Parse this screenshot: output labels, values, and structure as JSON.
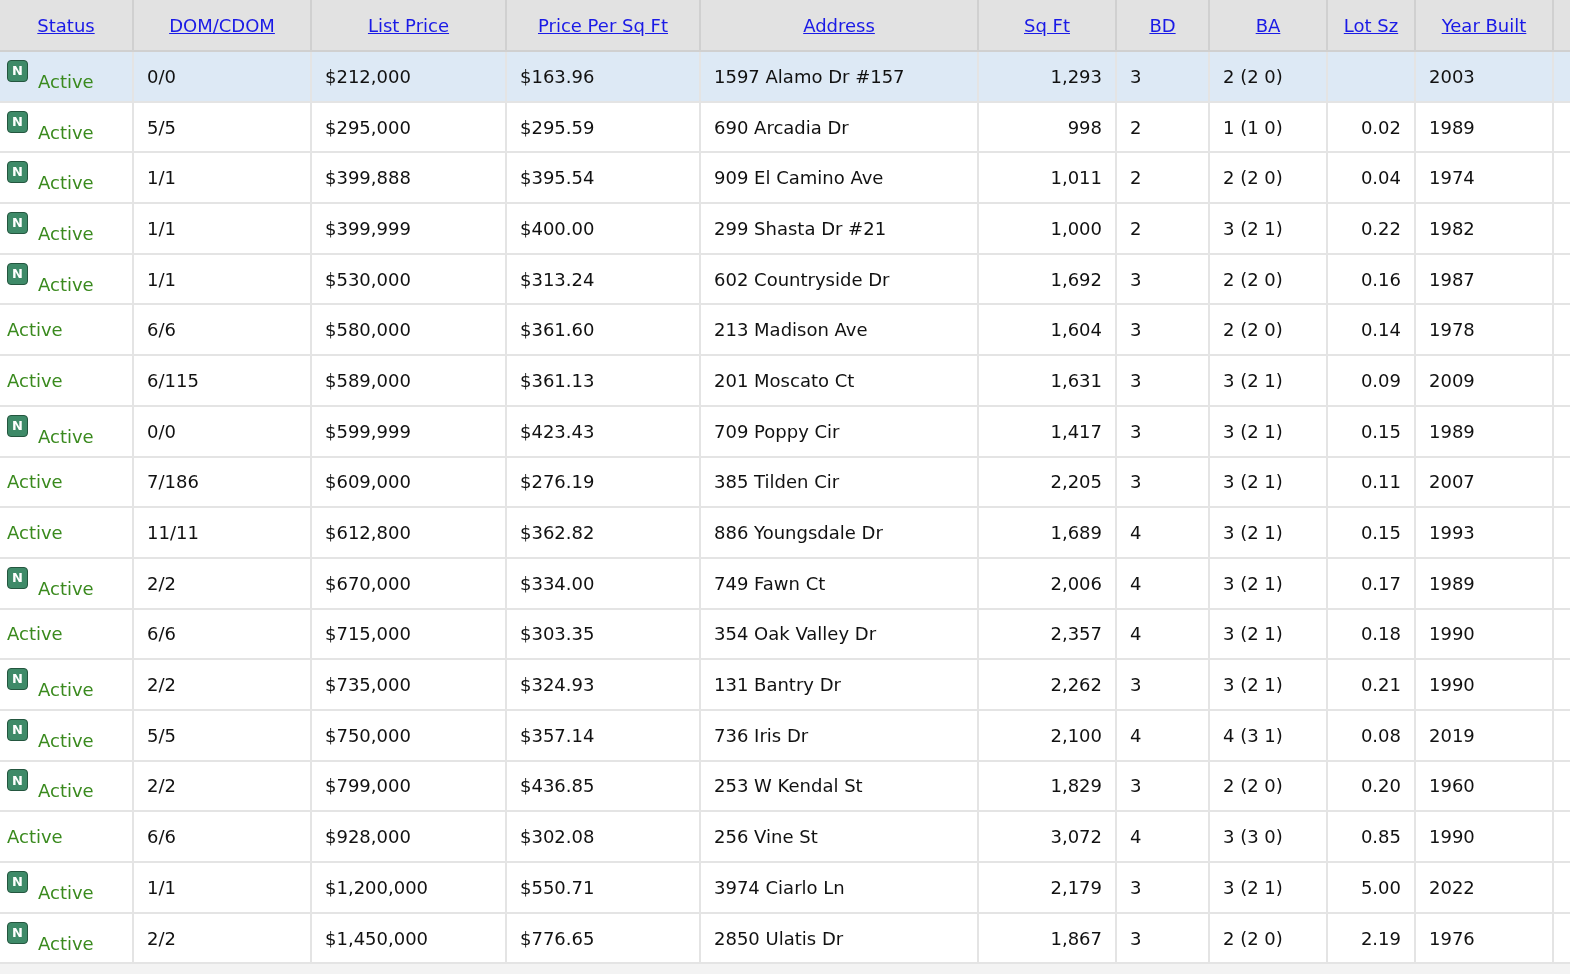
{
  "columns": [
    "Status",
    "DOM/CDOM",
    "List Price",
    "Price Per Sq Ft",
    "Address",
    "Sq Ft",
    "BD",
    "BA",
    "Lot Sz",
    "Year Built"
  ],
  "rows": [
    {
      "selected": true,
      "badge": "N",
      "status": "Active",
      "dom": "0/0",
      "price": "$212,000",
      "ppsf": "$163.96",
      "address": "1597 Alamo Dr #157",
      "sqft": "1,293",
      "bd": "3",
      "ba": "2 (2 0)",
      "year": "2003"
    },
    {
      "selected": false,
      "badge": "N",
      "status": "Active",
      "dom": "5/5",
      "price": "$295,000",
      "ppsf": "$295.59",
      "address": "690 Arcadia Dr",
      "sqft": "998",
      "bd": "2",
      "ba": "1 (1 0)",
      "lot": "0.02",
      "year": "1989"
    },
    {
      "selected": false,
      "badge": "N",
      "status": "Active",
      "dom": "1/1",
      "price": "$399,888",
      "ppsf": "$395.54",
      "address": "909 El Camino Ave",
      "sqft": "1,011",
      "bd": "2",
      "ba": "2 (2 0)",
      "lot": "0.04",
      "year": "1974"
    },
    {
      "selected": false,
      "badge": "N",
      "status": "Active",
      "dom": "1/1",
      "price": "$399,999",
      "ppsf": "$400.00",
      "address": "299 Shasta Dr #21",
      "sqft": "1,000",
      "bd": "2",
      "ba": "3 (2 1)",
      "lot": "0.22",
      "year": "1982"
    },
    {
      "selected": false,
      "badge": "N",
      "status": "Active",
      "dom": "1/1",
      "price": "$530,000",
      "ppsf": "$313.24",
      "address": "602 Countryside Dr",
      "sqft": "1,692",
      "bd": "3",
      "ba": "2 (2 0)",
      "lot": "0.16",
      "year": "1987"
    },
    {
      "selected": false,
      "status": "Active",
      "dom": "6/6",
      "price": "$580,000",
      "ppsf": "$361.60",
      "address": "213 Madison Ave",
      "sqft": "1,604",
      "bd": "3",
      "ba": "2 (2 0)",
      "lot": "0.14",
      "year": "1978"
    },
    {
      "selected": false,
      "status": "Active",
      "dom": "6/115",
      "price": "$589,000",
      "ppsf": "$361.13",
      "address": "201 Moscato Ct",
      "sqft": "1,631",
      "bd": "3",
      "ba": "3 (2 1)",
      "lot": "0.09",
      "year": "2009"
    },
    {
      "selected": false,
      "badge": "N",
      "status": "Active",
      "dom": "0/0",
      "price": "$599,999",
      "ppsf": "$423.43",
      "address": "709 Poppy Cir",
      "sqft": "1,417",
      "bd": "3",
      "ba": "3 (2 1)",
      "lot": "0.15",
      "year": "1989"
    },
    {
      "selected": false,
      "status": "Active",
      "dom": "7/186",
      "price": "$609,000",
      "ppsf": "$276.19",
      "address": "385 Tilden Cir",
      "sqft": "2,205",
      "bd": "3",
      "ba": "3 (2 1)",
      "lot": "0.11",
      "year": "2007"
    },
    {
      "selected": false,
      "status": "Active",
      "dom": "11/11",
      "price": "$612,800",
      "ppsf": "$362.82",
      "address": "886 Youngsdale Dr",
      "sqft": "1,689",
      "bd": "4",
      "ba": "3 (2 1)",
      "lot": "0.15",
      "year": "1993"
    },
    {
      "selected": false,
      "badge": "N",
      "status": "Active",
      "dom": "2/2",
      "price": "$670,000",
      "ppsf": "$334.00",
      "address": "749 Fawn Ct",
      "sqft": "2,006",
      "bd": "4",
      "ba": "3 (2 1)",
      "lot": "0.17",
      "year": "1989"
    },
    {
      "selected": false,
      "status": "Active",
      "dom": "6/6",
      "price": "$715,000",
      "ppsf": "$303.35",
      "address": "354 Oak Valley Dr",
      "sqft": "2,357",
      "bd": "4",
      "ba": "3 (2 1)",
      "lot": "0.18",
      "year": "1990"
    },
    {
      "selected": false,
      "badge": "N",
      "status": "Active",
      "dom": "2/2",
      "price": "$735,000",
      "ppsf": "$324.93",
      "address": "131 Bantry Dr",
      "sqft": "2,262",
      "bd": "3",
      "ba": "3 (2 1)",
      "lot": "0.21",
      "year": "1990"
    },
    {
      "selected": false,
      "badge": "N",
      "status": "Active",
      "dom": "5/5",
      "price": "$750,000",
      "ppsf": "$357.14",
      "address": "736 Iris Dr",
      "sqft": "2,100",
      "bd": "4",
      "ba": "4 (3 1)",
      "lot": "0.08",
      "year": "2019"
    },
    {
      "selected": false,
      "badge": "N",
      "status": "Active",
      "dom": "2/2",
      "price": "$799,000",
      "ppsf": "$436.85",
      "address": "253 W Kendal St",
      "sqft": "1,829",
      "bd": "3",
      "ba": "2 (2 0)",
      "lot": "0.20",
      "year": "1960"
    },
    {
      "selected": false,
      "status": "Active",
      "dom": "6/6",
      "price": "$928,000",
      "ppsf": "$302.08",
      "address": "256 Vine St",
      "sqft": "3,072",
      "bd": "4",
      "ba": "3 (3 0)",
      "lot": "0.85",
      "year": "1990"
    },
    {
      "selected": false,
      "badge": "N",
      "status": "Active",
      "dom": "1/1",
      "price": "$1,200,000",
      "ppsf": "$550.71",
      "address": "3974 Ciarlo Ln",
      "sqft": "2,179",
      "bd": "3",
      "ba": "3 (2 1)",
      "lot": "5.00",
      "year": "2022"
    },
    {
      "selected": false,
      "badge": "N",
      "status": "Active",
      "dom": "2/2",
      "price": "$1,450,000",
      "ppsf": "$776.65",
      "address": "2850 Ulatis Dr",
      "sqft": "1,867",
      "bd": "3",
      "ba": "2 (2 0)",
      "lot": "2.19",
      "year": "1976"
    }
  ]
}
